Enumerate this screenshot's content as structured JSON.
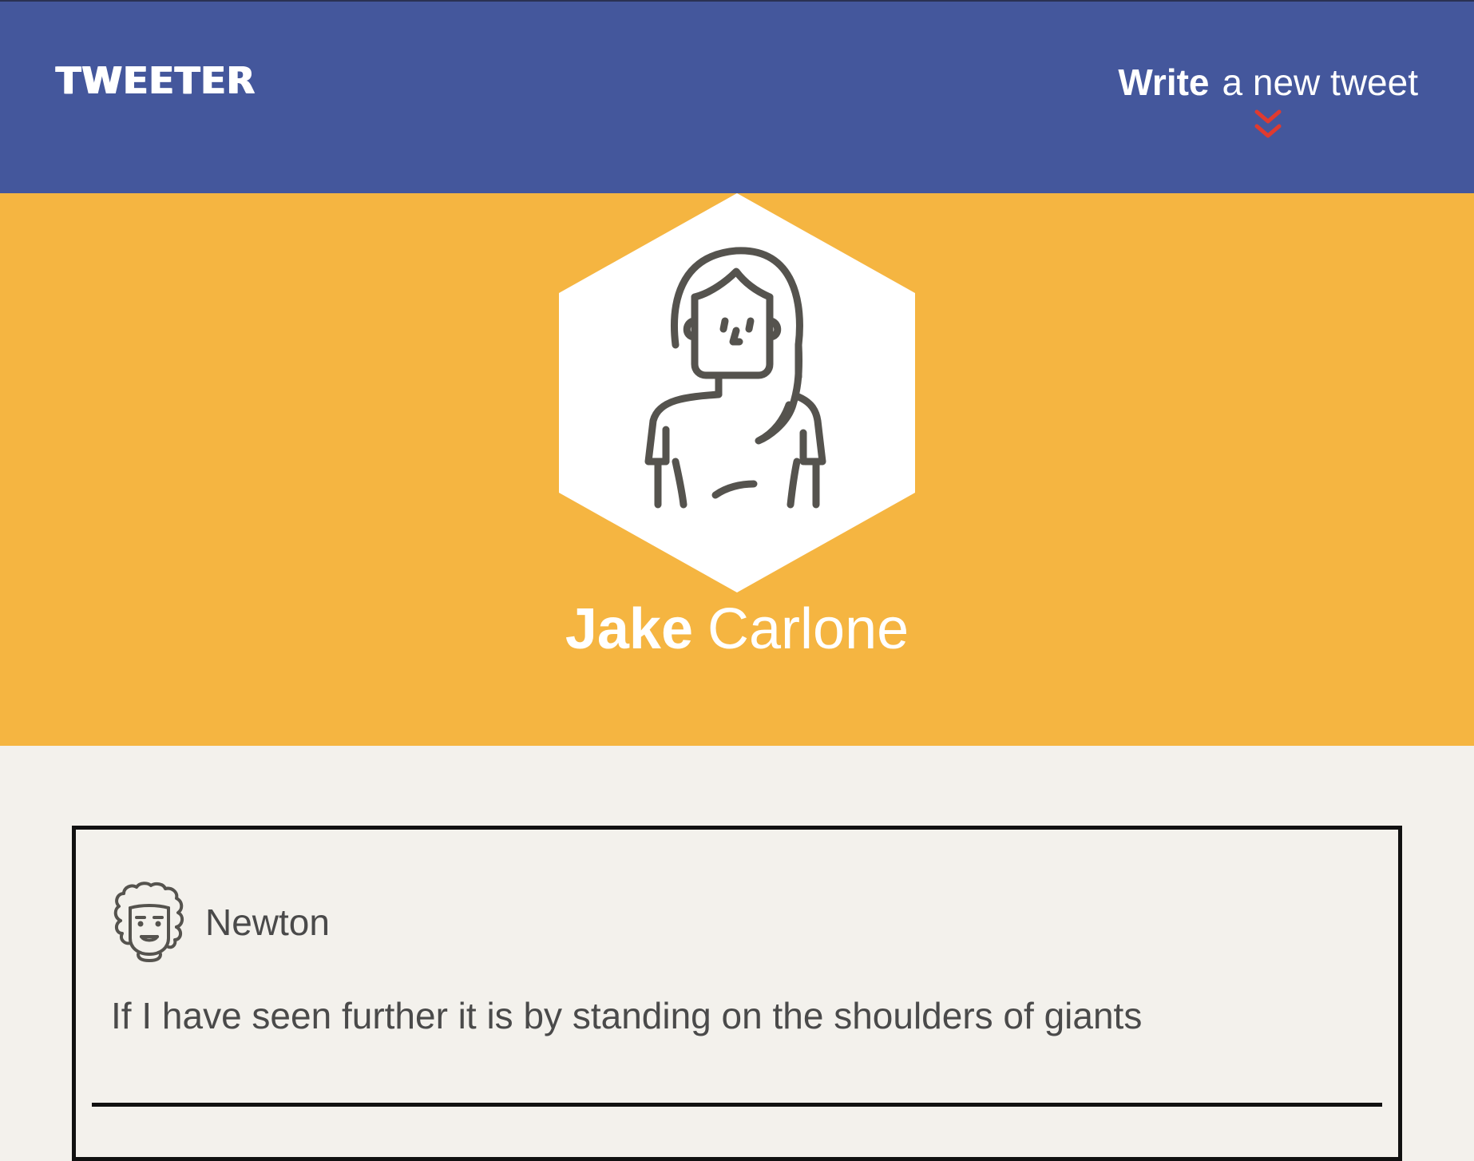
{
  "nav": {
    "brand": "TWEETER",
    "write_bold": "Write",
    "write_rest": "a new tweet"
  },
  "profile": {
    "first_name": "Jake",
    "last_name": "Carlone",
    "avatar_icon": "woman-avatar-icon"
  },
  "tweets": [
    {
      "author": "Newton",
      "avatar_icon": "newton-avatar-icon",
      "text": "If I have seen further it is by standing on the shoulders of giants"
    }
  ],
  "colors": {
    "nav_bg": "#44579c",
    "hero_bg": "#f5b541",
    "page_bg": "#f3f1ec",
    "accent_red": "#e03a2f",
    "icon_stroke": "#55534e"
  }
}
